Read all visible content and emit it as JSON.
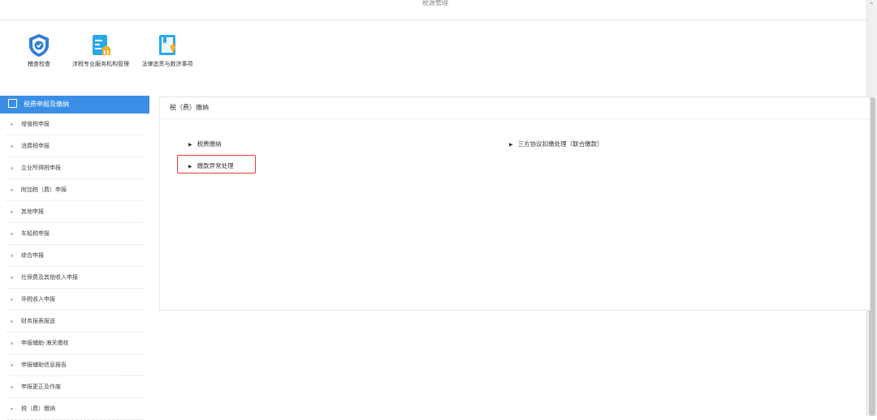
{
  "window": {
    "title": "税源管理"
  },
  "toolbar_icons": [
    {
      "label": "稽查检查",
      "icon": "shield-check-icon"
    },
    {
      "label": "涉税专业服务机构管理",
      "icon": "document-building-icon"
    },
    {
      "label": "法律追责与救济事项",
      "icon": "law-book-icon"
    }
  ],
  "sidebar": {
    "header": "税费申报及缴纳",
    "items": [
      "增值税申报",
      "消费税申报",
      "企业所得税申报",
      "附加税（费）申报",
      "其他申报",
      "车船税申报",
      "综合申报",
      "社保费及其他收入申报",
      "非税收入申报",
      "财务报表报送",
      "申报辅助-海关缴核",
      "申报辅助信息报告",
      "申报更正及作废",
      "税（费）缴纳"
    ]
  },
  "panel": {
    "title": "税（费）缴纳",
    "links": [
      {
        "label": "税费缴纳"
      },
      {
        "label": "三方协议扣缴处理（联合缴款）"
      },
      {
        "label": "缴款异常处理",
        "highlighted": true
      }
    ]
  },
  "colors": {
    "accent": "#3a8ee6",
    "highlight": "#e53935"
  }
}
